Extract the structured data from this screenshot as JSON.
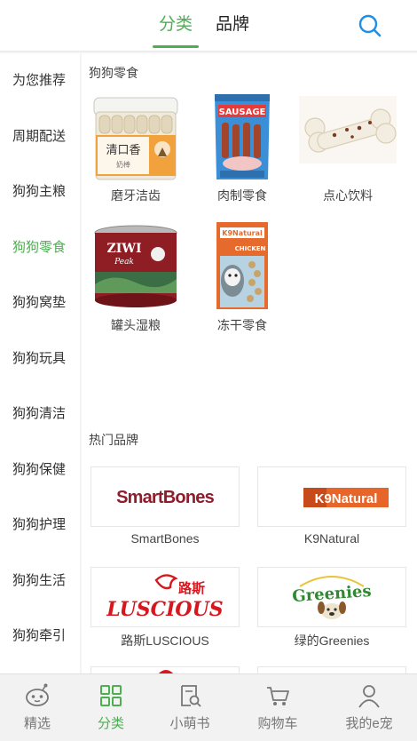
{
  "header": {
    "tabs": [
      {
        "label": "分类",
        "active": true
      },
      {
        "label": "品牌",
        "active": false
      }
    ],
    "search_icon": "search-icon",
    "accent_color": "#4caf50"
  },
  "sidebar": {
    "items": [
      {
        "label": "为您推荐",
        "active": false
      },
      {
        "label": "周期配送",
        "active": false
      },
      {
        "label": "狗狗主粮",
        "active": false
      },
      {
        "label": "狗狗零食",
        "active": true
      },
      {
        "label": "狗狗窝垫",
        "active": false
      },
      {
        "label": "狗狗玩具",
        "active": false
      },
      {
        "label": "狗狗清洁",
        "active": false
      },
      {
        "label": "狗狗保健",
        "active": false
      },
      {
        "label": "狗狗护理",
        "active": false
      },
      {
        "label": "狗狗生活",
        "active": false
      },
      {
        "label": "狗狗牵引",
        "active": false
      }
    ]
  },
  "category": {
    "title": "狗狗零食",
    "products": [
      {
        "label": "磨牙洁齿",
        "jar_text": "清口香",
        "jar_sub": "奶棒"
      },
      {
        "label": "肉制零食",
        "bag_text": "SAUSAGE"
      },
      {
        "label": "点心饮料"
      },
      {
        "label": "罐头湿粮",
        "can_text": "ZIWI",
        "can_sub": "Peak"
      },
      {
        "label": "冻干零食",
        "bag_text": "K9Natural",
        "bag_sub": "CHICKEN"
      }
    ]
  },
  "brands": {
    "title": "热门品牌",
    "items": [
      {
        "name": "SmartBones",
        "logo_text": "SmartBones"
      },
      {
        "name": "K9Natural",
        "logo_text": "K9Natural"
      },
      {
        "name": "路斯LUSCIOUS",
        "logo_cn": "路斯",
        "logo_text": "LUSCIOUS"
      },
      {
        "name": "绿的Greenies",
        "logo_text": "Greenies"
      }
    ]
  },
  "bottom_nav": {
    "items": [
      {
        "label": "精选",
        "icon": "pet-face-icon",
        "active": false
      },
      {
        "label": "分类",
        "icon": "grid-icon",
        "active": true
      },
      {
        "label": "小萌书",
        "icon": "book-search-icon",
        "active": false
      },
      {
        "label": "购物车",
        "icon": "cart-icon",
        "active": false
      },
      {
        "label": "我的e宠",
        "icon": "user-icon",
        "active": false
      }
    ]
  }
}
